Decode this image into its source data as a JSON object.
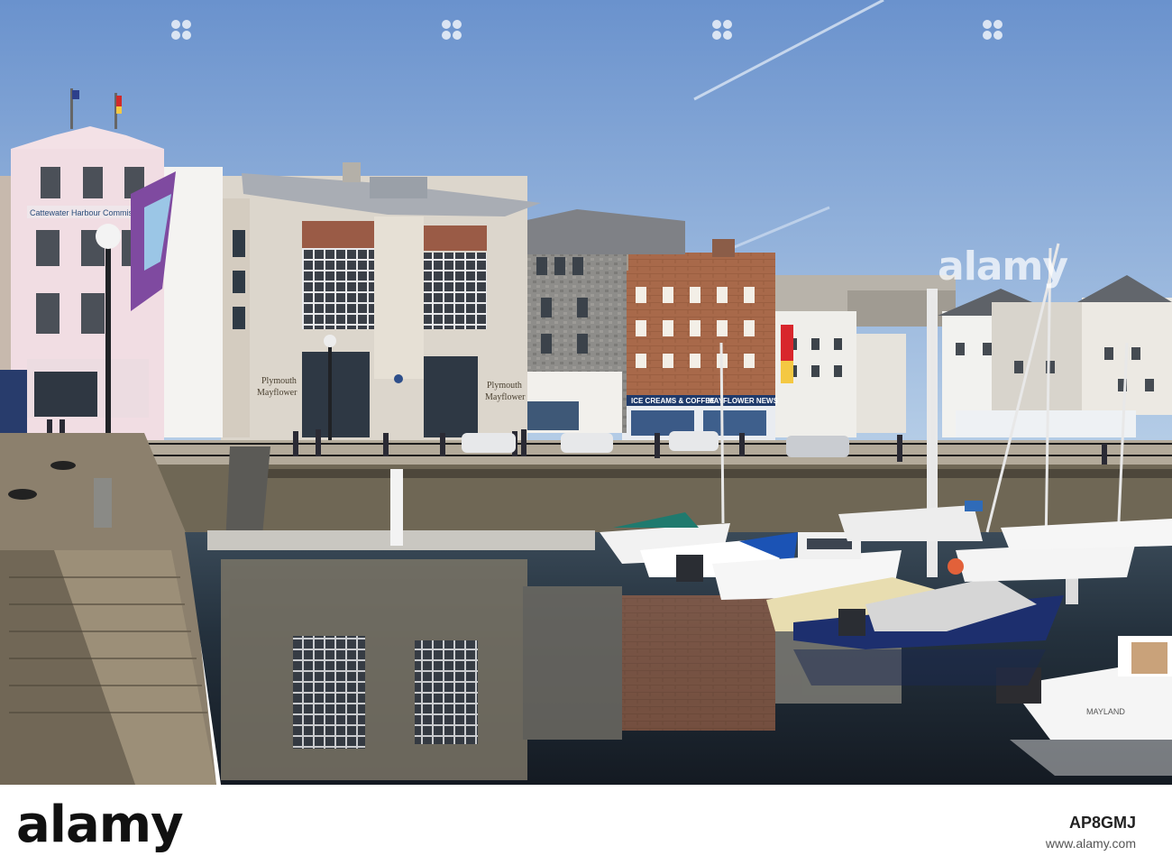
{
  "photo": {
    "building_sign": "Cattewater Harbour Commissioners",
    "centre_plaque_line1": "Plymouth",
    "centre_plaque_line2": "Mayflower",
    "right_plaque_line1": "Plymouth",
    "right_plaque_line2": "Mayflower",
    "shop_sign": "ICE CREAMS & COFFEE",
    "news_sign": "MAYFLOWER NEWS",
    "boat_name": "MAYLAND",
    "watermark_text": "alamy"
  },
  "footer": {
    "brand": "alamy",
    "image_id": "AP8GMJ",
    "site": "www.alamy.com"
  },
  "colors": {
    "sky_top": "#6f96cf",
    "sky_bottom": "#b6cde6",
    "water": "#1d2a3a",
    "quay": "#8a7d6a"
  },
  "icons": [
    "watermark-dot-icon"
  ]
}
